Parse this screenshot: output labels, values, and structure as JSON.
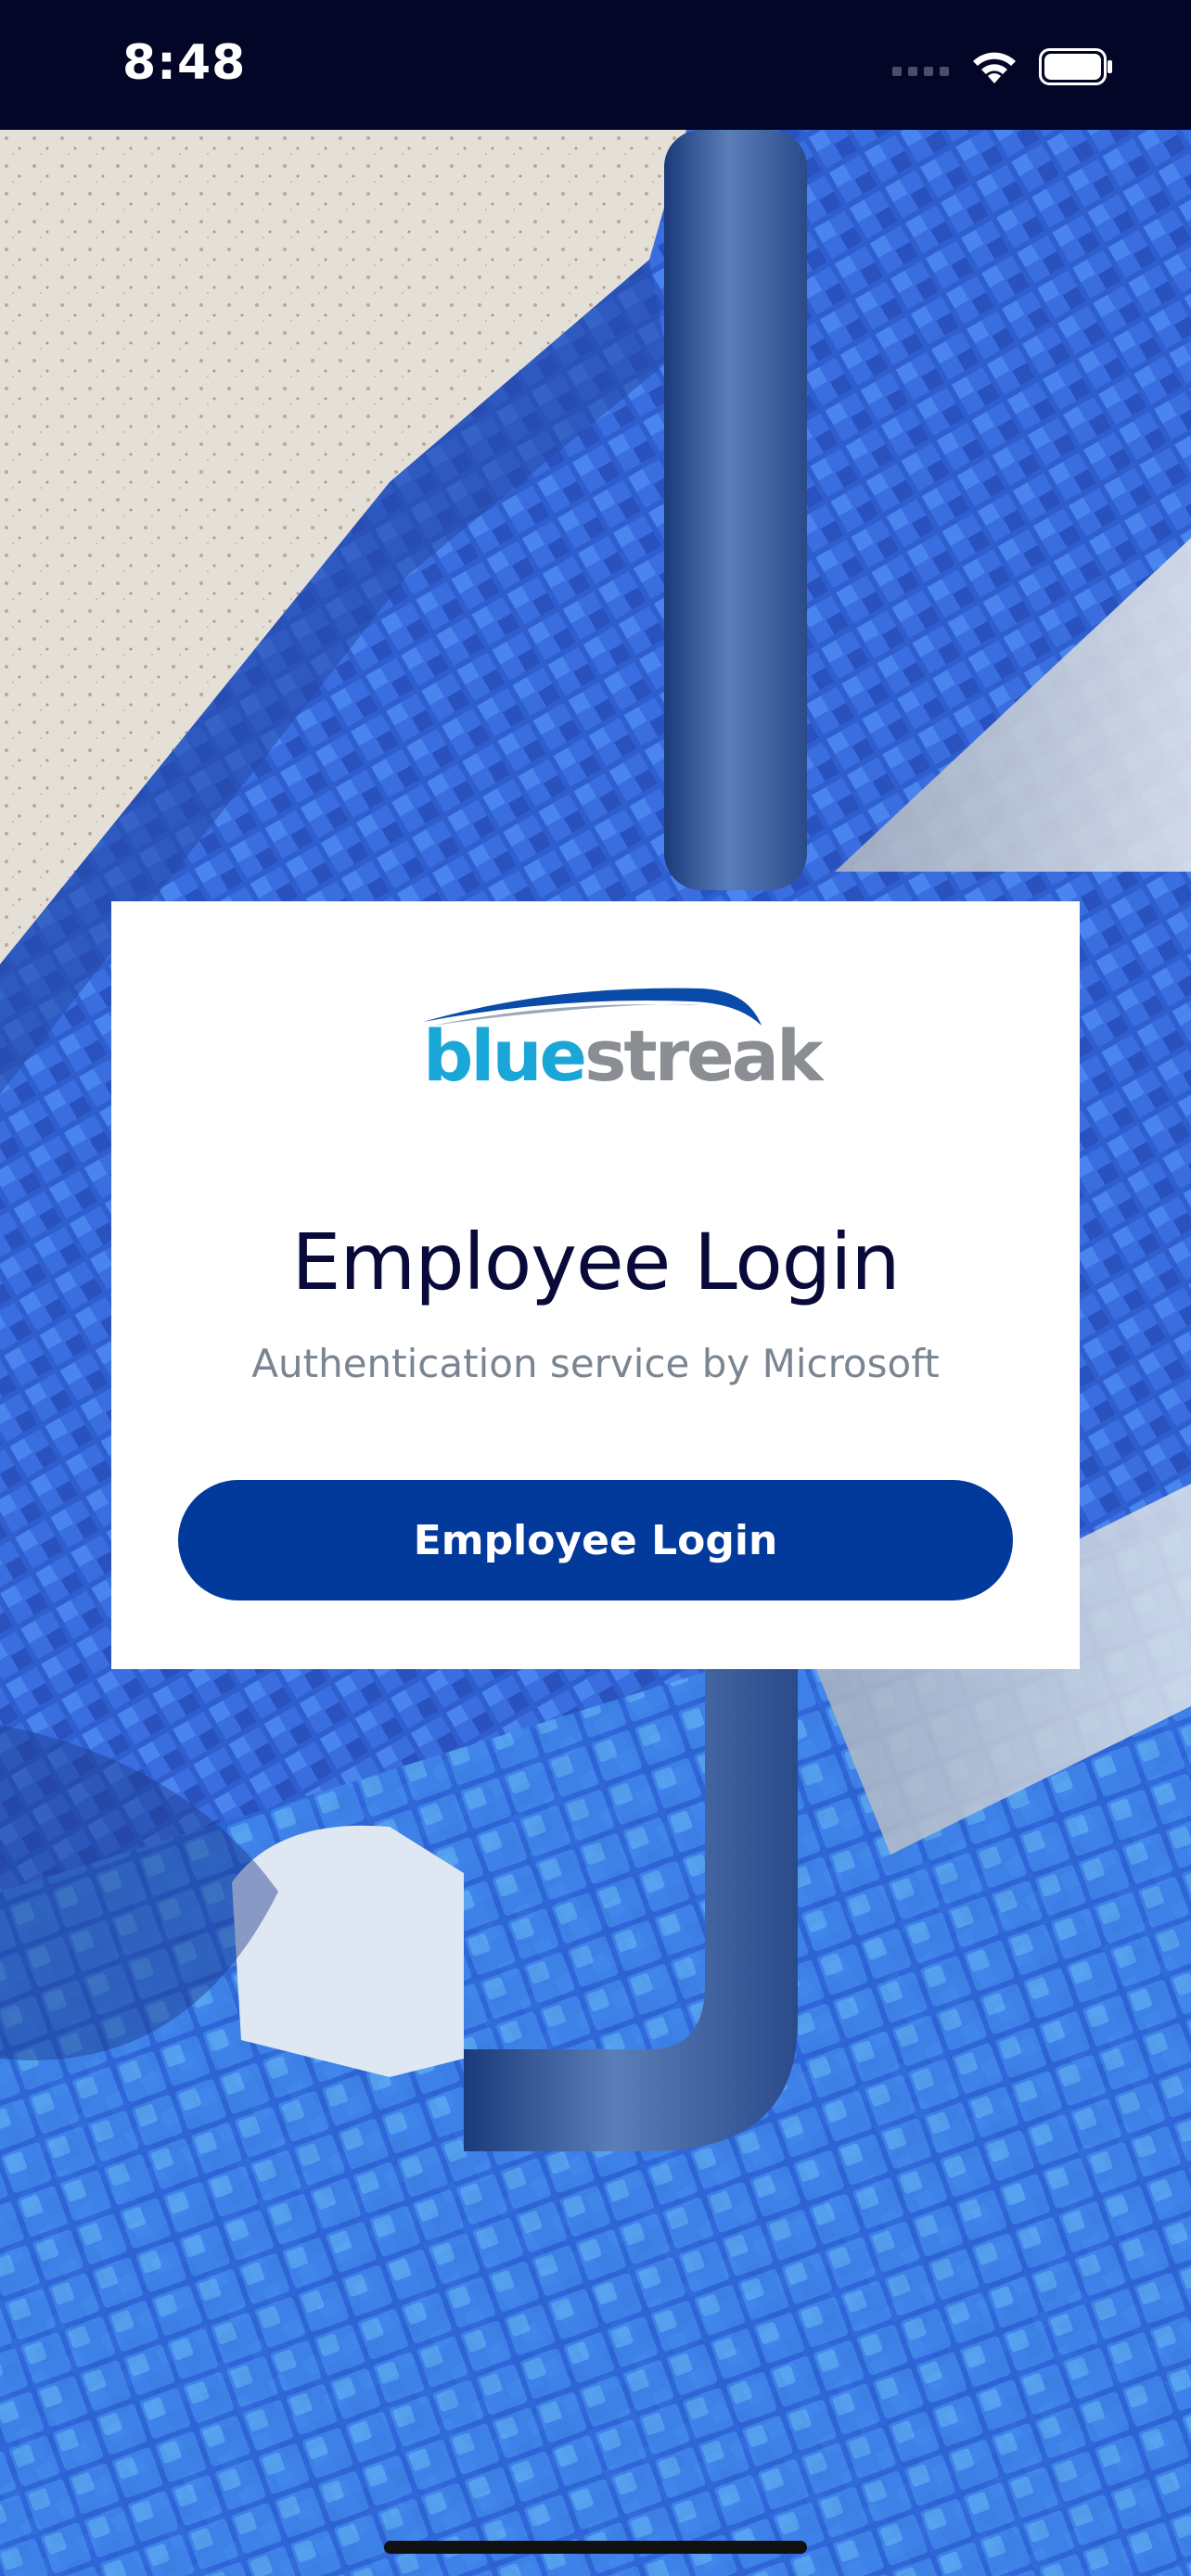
{
  "status_bar": {
    "time": "8:48",
    "icons": [
      "cellular-signal-icon",
      "wifi-icon",
      "battery-icon"
    ]
  },
  "background": {
    "description_icon": "pool-tiles-ladder-image"
  },
  "login_card": {
    "logo": {
      "part1": "blue",
      "part2": "streak",
      "colors": {
        "blue": "#1aa7d8",
        "gray": "#8a8d91",
        "swoosh": "#0a4aa8"
      }
    },
    "title": "Employee Login",
    "subtitle": "Authentication service by Microsoft",
    "button_label": "Employee Login"
  },
  "colors": {
    "status_bar_bg": "#040628",
    "button_bg": "#023a9c",
    "title": "#0a0a3a",
    "subtitle": "#7b8592"
  }
}
